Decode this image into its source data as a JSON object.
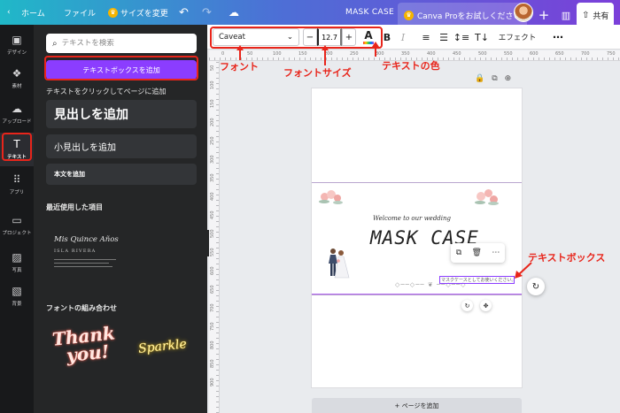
{
  "topbar": {
    "back": "‹",
    "home": "ホーム",
    "file": "ファイル",
    "resize": "サイズを変更",
    "crown": "♛",
    "undo": "↶",
    "redo": "↷",
    "cloud": "☁",
    "doc_title": "MASK CASE",
    "try_pro": "Canva Proをお試しください",
    "plus": "+",
    "stats": "▥",
    "share_icon": "⇧",
    "share": "共有"
  },
  "rail": {
    "items": [
      {
        "icon": "▣",
        "label": "デザイン"
      },
      {
        "icon": "❖",
        "label": "素材"
      },
      {
        "icon": "☁",
        "label": "アップロード"
      },
      {
        "icon": "T",
        "label": "テキスト"
      },
      {
        "icon": "⠿",
        "label": "アプリ"
      },
      {
        "icon": "▭",
        "label": "プロジェクト"
      },
      {
        "icon": "▨",
        "label": "写真"
      },
      {
        "icon": "▧",
        "label": "背景"
      }
    ]
  },
  "panel": {
    "search_icon": "⌕",
    "search_placeholder": "テキストを検索",
    "add_textbox": "テキストボックスを追加",
    "hint": "テキストをクリックしてページに追加",
    "heading": "見出しを追加",
    "subheading": "小見出しを追加",
    "body": "本文を追加",
    "recent_heading": "最近使用した項目",
    "recent_title": "Mis Quince Años",
    "recent_sub": "ISLA RIVERA",
    "combos_heading": "フォントの組み合わせ",
    "thank_1": "Thank",
    "thank_2": "you!",
    "sparkle": "Sparkle",
    "collapse": "‹"
  },
  "toolbar": {
    "font": "Caveat",
    "chevron": "⌄",
    "minus": "−",
    "size": "12.7",
    "plus": "+",
    "color_letter": "A",
    "bold": "B",
    "italic": "I",
    "align": "≡",
    "list": "☰",
    "spacing": "↕≡",
    "vertical": "T↓",
    "effect": "エフェクト",
    "more": "⋯"
  },
  "annotations": {
    "font": "フォント",
    "font_size": "フォントサイズ",
    "text_color": "テキストの色",
    "textbox": "テキストボックス"
  },
  "rulers": {
    "top": [
      "0",
      "50",
      "100",
      "150",
      "200",
      "250",
      "300",
      "350",
      "400",
      "450",
      "500",
      "550",
      "600",
      "650",
      "700",
      "750"
    ],
    "left": [
      "50",
      "100",
      "150",
      "200",
      "250",
      "300",
      "350",
      "400",
      "450",
      "500",
      "550",
      "600",
      "650",
      "700",
      "750",
      "800",
      "850",
      "900"
    ]
  },
  "page": {
    "icons": {
      "lock": "🔒",
      "duplicate": "⧉",
      "add": "⊕"
    },
    "welcome": "Welcome to our wedding",
    "title": "MASK CASE",
    "ornament": "◇──◇── ❦ ──◇──◇",
    "selected_text": "マスクケースとしてお使いください。",
    "float_copy": "⧉",
    "float_delete": "🗑",
    "float_more": "⋯",
    "rotate": "↻",
    "handle_rotate": "↻",
    "handle_move": "✥",
    "add_page": "+ ページを追加"
  }
}
